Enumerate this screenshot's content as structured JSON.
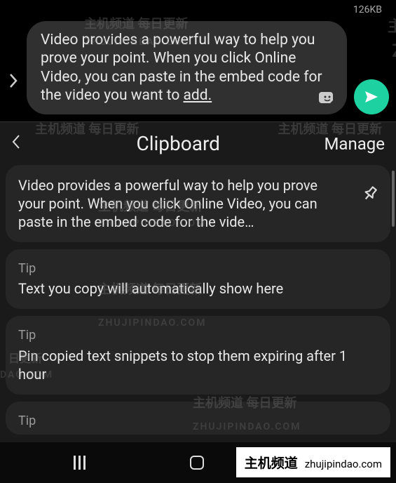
{
  "topbar": {
    "filesize": "126KB"
  },
  "compose": {
    "text_main": "Video provides a powerful way to help you prove your point. When you click Online Video, you can paste in the embed code for the video you want to ",
    "text_underline": "add."
  },
  "clipboard": {
    "title": "Clipboard",
    "manage": "Manage",
    "items": [
      {
        "label": "",
        "text": "Video provides a powerful way to help you prove your point. When you click Online Video, you can paste in the embed code for the vide…",
        "pinned": false,
        "show_pin": true
      },
      {
        "label": "Tip",
        "text": "Text you copy will automatically show here",
        "pinned": false,
        "show_pin": false
      },
      {
        "label": "Tip",
        "text": "Pin copied text snippets to stop them expiring after 1 hour",
        "pinned": false,
        "show_pin": false
      },
      {
        "label": "Tip",
        "text": "",
        "pinned": false,
        "show_pin": false
      }
    ]
  },
  "watermarks": {
    "cn": "主机频道 每日更新",
    "en": "ZHUJIPINDAO.COM"
  },
  "brand": {
    "main": "主机频道",
    "sub": "zhujipindao.com"
  }
}
